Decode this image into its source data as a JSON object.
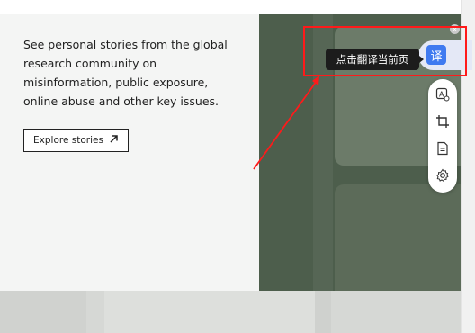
{
  "promo": {
    "description_lines": [
      "See personal stories from the global",
      "research community on",
      "misinformation, public exposure,",
      "online abuse and other key issues."
    ],
    "cta_label": "Explore stories",
    "cta_icon": "arrow-up-right-icon"
  },
  "translate_plugin": {
    "tooltip": "点击翻译当前页",
    "button_glyph": "译",
    "tools": [
      "image-translate-icon",
      "crop-icon",
      "document-icon",
      "settings-icon"
    ],
    "accent_color": "#3f7af0",
    "highlight_color": "#ff1a1a"
  }
}
